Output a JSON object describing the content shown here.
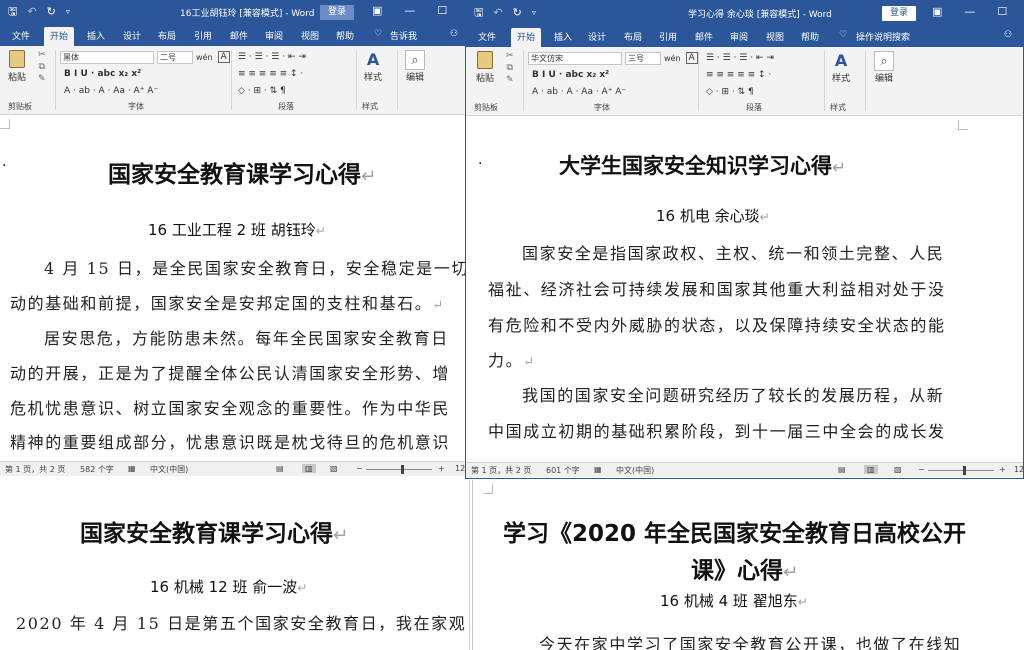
{
  "ribbon_tabs": [
    "文件",
    "开始",
    "插入",
    "设计",
    "布局",
    "引用",
    "邮件",
    "审阅",
    "视图",
    "帮助"
  ],
  "ribbon": {
    "paste": "粘贴",
    "clipboard": "剪贴板",
    "font_group": "字体",
    "paragraph_group": "段落",
    "styles": "样式",
    "edit": "编辑",
    "font_row2": "B  I  U  ·  abc  x₂  x²",
    "font_row3": "A ·  ab ·  A ·  Aa ·  A⁺  A⁻",
    "para_row1": "☰ ·  ☰ ·  ☰ ·  ⇤  ⇥",
    "para_row2": "≡  ≡  ≡  ≡  ≡  ↕ ·",
    "para_row3": "◇ ·  ⊞ ·  ⇅  ¶"
  },
  "windows": [
    {
      "title": "16工业胡钰玲 [兼容模式] - Word",
      "login": "登录",
      "tell_me": "告诉我",
      "font_name": "黑体",
      "font_size": "二号",
      "doc": {
        "title": "国家安全教育课学习心得",
        "subtitle": "16 工业工程 2 班  胡钰玲",
        "lines": [
          "4 月 15 日，是全民国家安全教育日，安全稳定是一切",
          "动的基础和前提，国家安全是安邦定国的支柱和基石。",
          "居安思危，方能防患未然。每年全民国家安全教育日",
          "动的开展，正是为了提醒全体公民认清国家安全形势、增",
          "危机忧患意识、树立国家安全观念的重要性。作为中华民",
          "精神的重要组成部分，忧患意识既是枕戈待旦的危机意识"
        ]
      },
      "status": {
        "page": "第 1 页，共 2 页",
        "words": "582 个字",
        "lang": "中文(中国)",
        "zoom": "12"
      }
    },
    {
      "title": "学习心得 余心琰 [兼容模式] - Word",
      "login": "登录",
      "tell_me": "操作说明搜索",
      "font_name": "华文仿宋",
      "font_size": "三号",
      "doc": {
        "title": "大学生国家安全知识学习心得",
        "subtitle": "16 机电    余心琰",
        "lines": [
          "国家安全是指国家政权、主权、统一和领土完整、人民",
          "福祉、经济社会可持续发展和国家其他重大利益相对处于没",
          "有危险和不受内外威胁的状态，以及保障持续安全状态的能",
          "力。",
          "我国的国家安全问题研究经历了较长的发展历程，从新",
          "中国成立初期的基础积累阶段，到十一届三中全会的成长发"
        ]
      },
      "status": {
        "page": "第 1 页，共 2 页",
        "words": "601 个字",
        "lang": "中文(中国)",
        "zoom": "12"
      }
    },
    {
      "doc": {
        "title": "国家安全教育课学习心得",
        "subtitle": "16 机械 12 班  俞一波",
        "lines": [
          "2020 年 4 月 15 日是第五个国家安全教育日，我在家观"
        ]
      }
    },
    {
      "doc": {
        "title_line1": "学习《2020 年全民国家安全教育日高校公开",
        "title_line2": "课》心得",
        "subtitle": "16 机械 4 班  翟旭东",
        "lines": [
          "今天在家中学习了国家安全教育公开课，也做了在线知"
        ]
      }
    }
  ],
  "icons": [
    "save-icon",
    "undo-icon",
    "redo-icon",
    "lightbulb-icon",
    "person-icon",
    "minimize-icon",
    "maximize-icon",
    "ribbon-display-icon",
    "search-icon",
    "styles-icon"
  ]
}
